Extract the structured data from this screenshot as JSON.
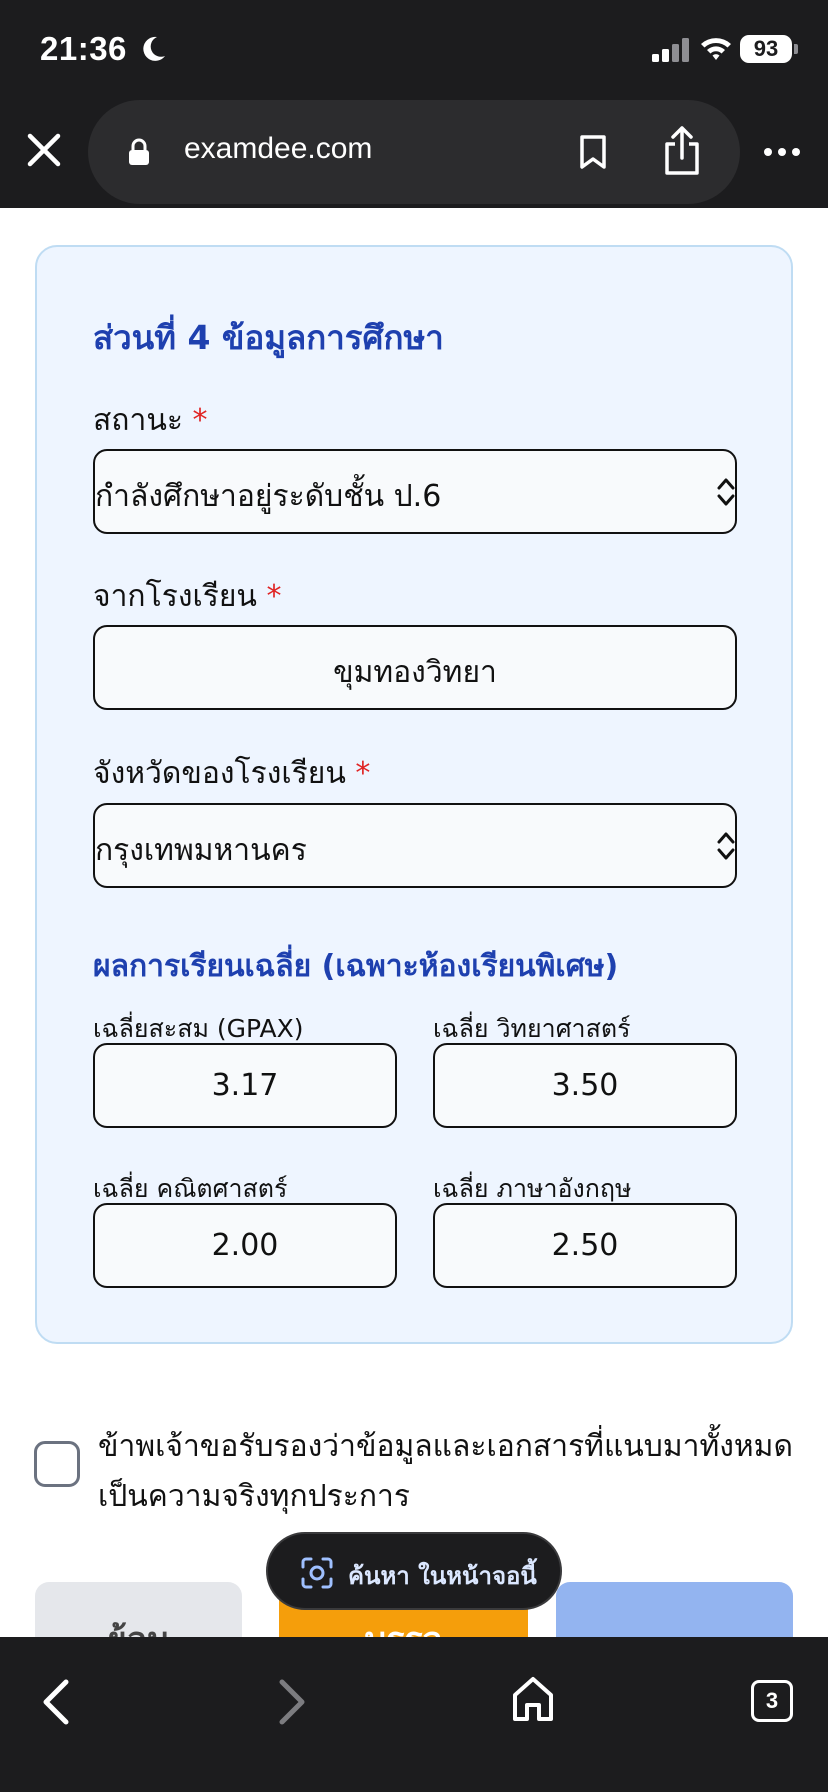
{
  "status_bar": {
    "time": "21:36",
    "battery": "93"
  },
  "browser": {
    "url": "examdee.com",
    "tab_count": "3"
  },
  "form": {
    "section_title": "ส่วนที่ 4 ข้อมูลการศึกษา",
    "required_mark": "*",
    "status": {
      "label": "สถานะ",
      "value": "กำลังศึกษาอยู่ระดับชั้น ป.6"
    },
    "school": {
      "label": "จากโรงเรียน",
      "value": "ขุมทองวิทยา"
    },
    "province": {
      "label": "จังหวัดของโรงเรียน",
      "value": "กรุงเทพมหานคร"
    },
    "grades": {
      "heading": "ผลการเรียนเฉลี่ย (เฉพาะห้องเรียนพิเศษ)",
      "gpax": {
        "label": "เฉลี่ยสะสม (GPAX)",
        "value": "3.17"
      },
      "science": {
        "label": "เฉลี่ย วิทยาศาสตร์",
        "value": "3.50"
      },
      "math": {
        "label": "เฉลี่ย คณิตศาสตร์",
        "value": "2.00"
      },
      "english": {
        "label": "เฉลี่ย ภาษาอังกฤษ",
        "value": "2.50"
      }
    }
  },
  "certify": {
    "checked": false,
    "text": "ข้าพเจ้าขอรับรองว่าข้อมูลและเอกสารที่แนบมาทั้งหมดเป็นความจริงทุกประการ"
  },
  "find_on_page": {
    "label": "ค้นหา ในหน้าจอนี้"
  },
  "buttons": {
    "left_peek": "ย้อน",
    "middle_peek": "บรรจ"
  },
  "colors": {
    "accent_blue": "#1e40af",
    "card_bg": "#eef5ff",
    "required_red": "#e02424",
    "orange_button": "#f59e0b",
    "blue_button": "#93b4f0"
  }
}
